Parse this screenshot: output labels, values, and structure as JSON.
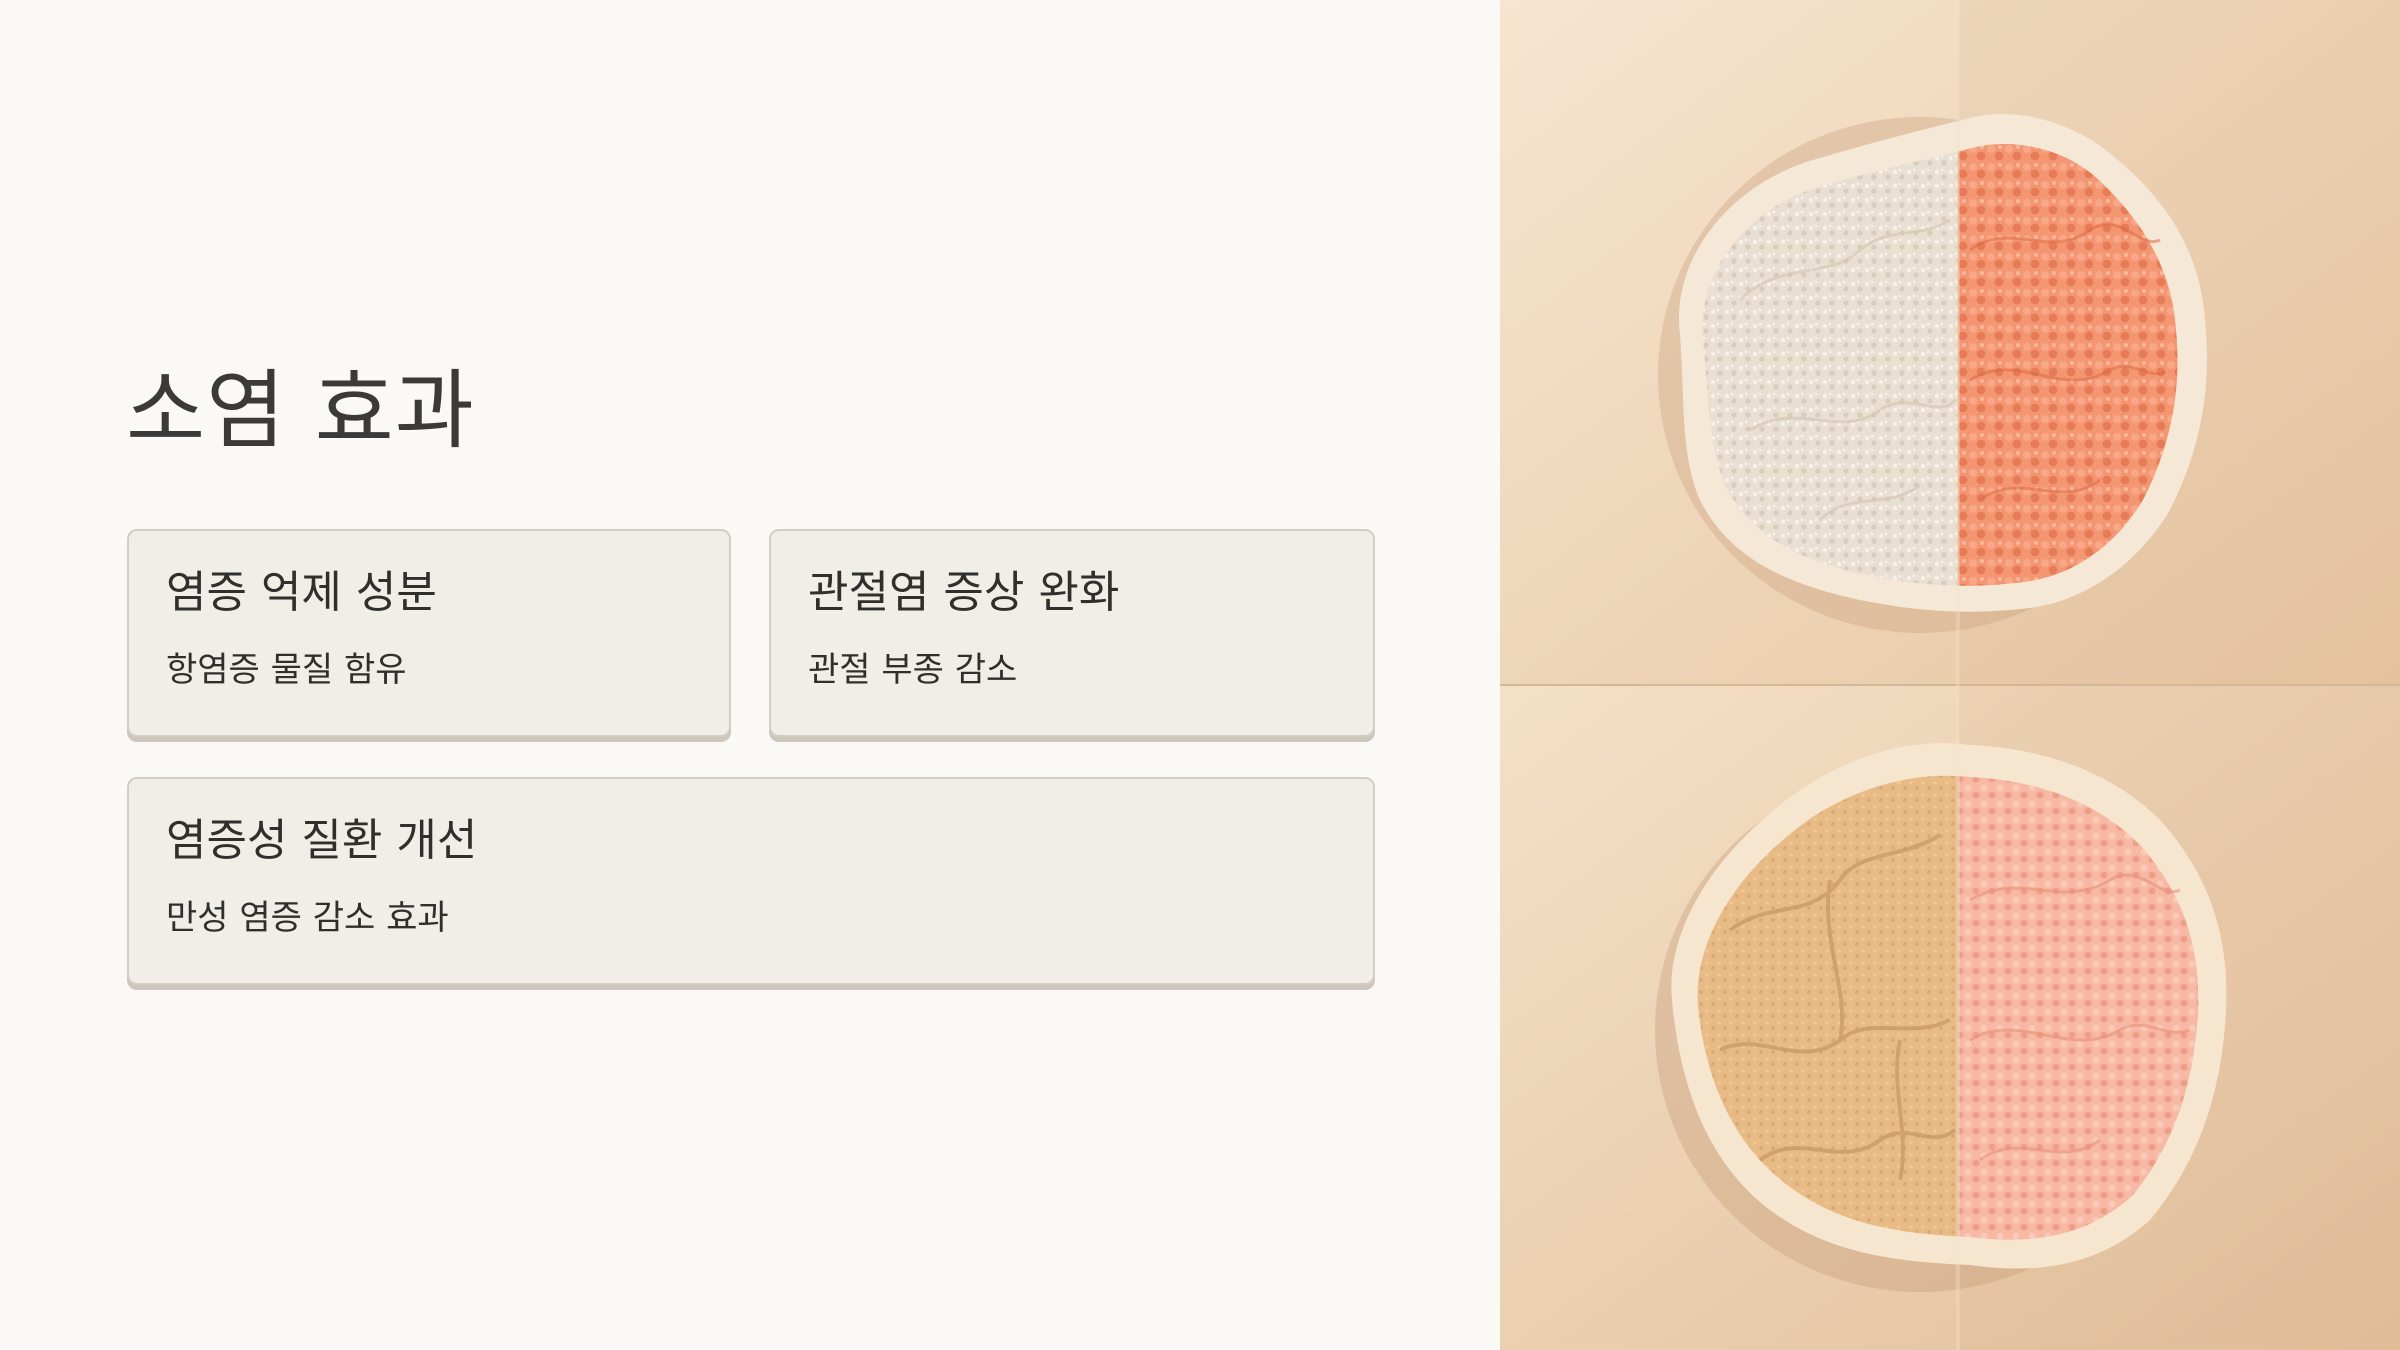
{
  "slide": {
    "title": "소염 효과",
    "cards": [
      {
        "title": "염증 억제 성분",
        "description": "항염증 물질 함유"
      },
      {
        "title": "관절염 증상 완화",
        "description": "관절 부종 감소"
      },
      {
        "title": "염증성 질환 개선",
        "description": "만성 염증 감소 효과"
      }
    ]
  },
  "image": {
    "subject": "two textured skin-like discs, split comparison halves",
    "colors": {
      "background": "#ecd2b4",
      "top_left_half": "#e8ddd0",
      "top_right_half": "#f4936e",
      "bottom_left_half": "#e6b883",
      "bottom_right_half": "#f6b5a0",
      "rim": "#f6ead8"
    }
  }
}
